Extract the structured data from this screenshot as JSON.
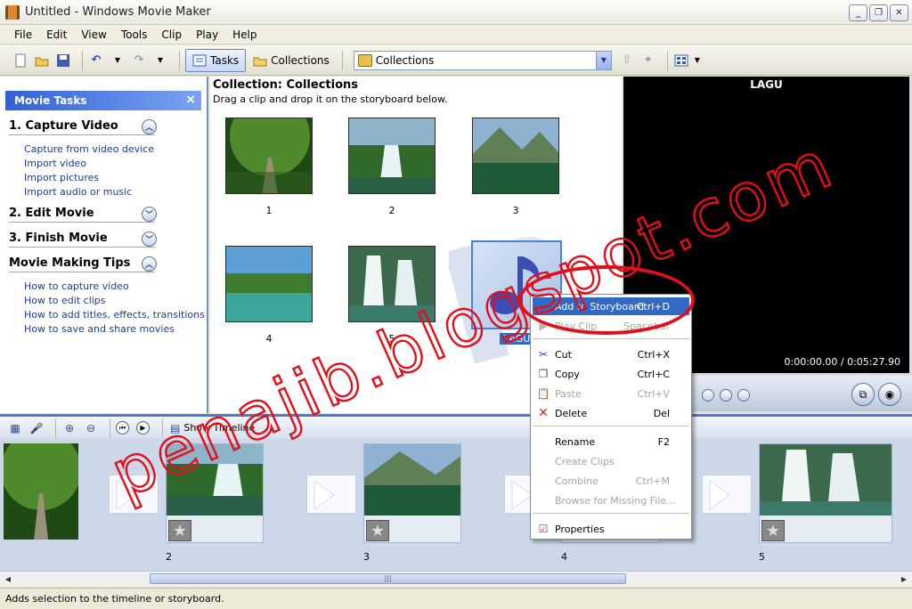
{
  "window": {
    "title": "Untitled - Windows Movie Maker",
    "minimize": "0",
    "maximize": "1",
    "close": "r"
  },
  "menu": [
    "File",
    "Edit",
    "View",
    "Tools",
    "Clip",
    "Play",
    "Help"
  ],
  "toolbar": {
    "tasks_label": "Tasks",
    "collections_label": "Collections",
    "collection_combo_value": "Collections"
  },
  "task_pane": {
    "header": "Movie Tasks",
    "close": "×",
    "sections": [
      {
        "title": "1. Capture Video",
        "toggle": "up",
        "links": [
          "Capture from video device",
          "Import video",
          "Import pictures",
          "Import audio or music"
        ]
      },
      {
        "title": "2. Edit Movie",
        "toggle": "down",
        "links": []
      },
      {
        "title": "3. Finish Movie",
        "toggle": "down",
        "links": []
      },
      {
        "title": "Movie Making Tips",
        "toggle": "up",
        "links": [
          "How to capture video",
          "How to edit clips",
          "How to add titles, effects, transitions",
          "How to save and share movies"
        ]
      }
    ]
  },
  "collection": {
    "title": "Collection: Collections",
    "subtitle": "Drag a clip and drop it on the storyboard below.",
    "clips": [
      "1",
      "2",
      "3",
      "4",
      "5"
    ],
    "music_label": "LAGU"
  },
  "preview": {
    "title": "LAGU",
    "time": "0:00:00.00 / 0:05:27.90"
  },
  "storyboard_toolbar": {
    "show_timeline": "Show Timeline"
  },
  "storyboard": {
    "numbers": [
      "2",
      "3",
      "4",
      "5"
    ]
  },
  "context_menu": {
    "items": [
      {
        "label": "Add to Storyboard",
        "shortcut": "Ctrl+D",
        "state": "highlighted"
      },
      {
        "label": "Play Clip",
        "shortcut": "Spacebar",
        "state": "disabled"
      },
      {
        "label": "Cut",
        "shortcut": "Ctrl+X",
        "state": "enabled"
      },
      {
        "label": "Copy",
        "shortcut": "Ctrl+C",
        "state": "enabled"
      },
      {
        "label": "Paste",
        "shortcut": "Ctrl+V",
        "state": "disabled"
      },
      {
        "label": "Delete",
        "shortcut": "Del",
        "state": "enabled"
      },
      {
        "label": "Rename",
        "shortcut": "F2",
        "state": "enabled"
      },
      {
        "label": "Create Clips",
        "shortcut": "",
        "state": "disabled"
      },
      {
        "label": "Combine",
        "shortcut": "Ctrl+M",
        "state": "disabled"
      },
      {
        "label": "Browse for Missing File...",
        "shortcut": "",
        "state": "disabled"
      },
      {
        "label": "Properties",
        "shortcut": "",
        "state": "enabled"
      }
    ]
  },
  "status_bar": {
    "text": "Adds selection to the timeline or storyboard."
  },
  "watermark": {
    "text": "penajib.blogspot.com"
  },
  "colors": {
    "accent_blue": "#316ac5",
    "annotation_red": "#e0101a"
  }
}
